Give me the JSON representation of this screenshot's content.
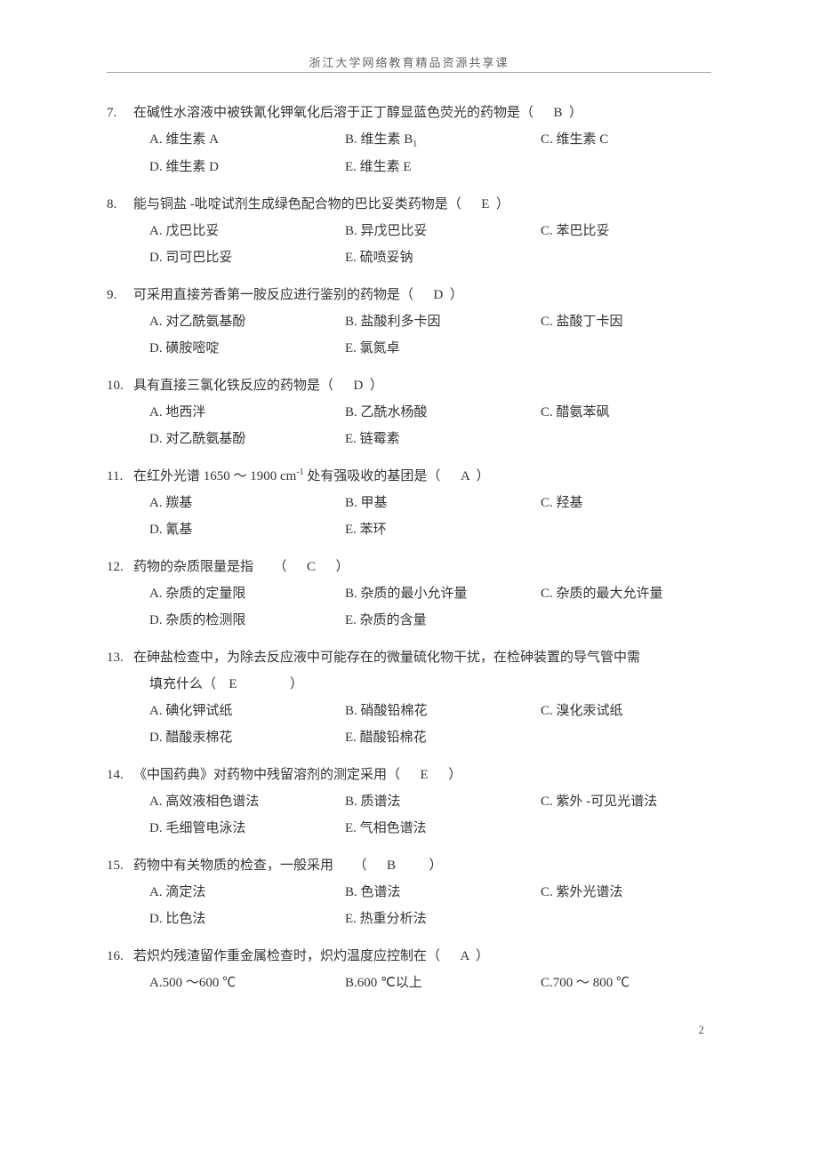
{
  "header": "浙江大学网络教育精品资源共享课",
  "page_number": "2",
  "questions": [
    {
      "num": "7.",
      "text_pre": "在碱性水溶液中被铁氰化钾氧化后溶于正丁醇显蓝色荧光的药物是（",
      "answer": "B",
      "text_post": "）",
      "rows": [
        [
          {
            "k": "A.",
            "v": "维生素 A"
          },
          {
            "k": "B.",
            "v": "维生素 B"
          },
          {
            "k": "C.",
            "v": "维生素 C"
          }
        ],
        [
          {
            "k": "D.",
            "v": "维生素 D"
          },
          {
            "k": "E.",
            "v": "维生素 E"
          }
        ]
      ],
      "b_sub": "1"
    },
    {
      "num": "8.",
      "text_pre": "能与铜盐 -吡啶试剂生成绿色配合物的巴比妥类药物是（",
      "answer": "E",
      "text_post": "）",
      "rows": [
        [
          {
            "k": "A.",
            "v": "戊巴比妥"
          },
          {
            "k": "B.",
            "v": "异戊巴比妥"
          },
          {
            "k": "C.",
            "v": "苯巴比妥"
          }
        ],
        [
          {
            "k": "D.",
            "v": "司可巴比妥"
          },
          {
            "k": "E.",
            "v": "硫喷妥钠"
          }
        ]
      ]
    },
    {
      "num": "9.",
      "text_pre": "可采用直接芳香第一胺反应进行鉴别的药物是（",
      "answer": "D",
      "text_post": "）",
      "rows": [
        [
          {
            "k": "A.",
            "v": "对乙酰氨基酚"
          },
          {
            "k": "B.",
            "v": "盐酸利多卡因"
          },
          {
            "k": "C.",
            "v": "盐酸丁卡因"
          }
        ],
        [
          {
            "k": "D.",
            "v": "磺胺嘧啶"
          },
          {
            "k": "E.",
            "v": "氯氮卓"
          }
        ]
      ]
    },
    {
      "num": "10.",
      "text_pre": "具有直接三氯化铁反应的药物是（",
      "answer": "D",
      "text_post": "）",
      "rows": [
        [
          {
            "k": "A.",
            "v": "地西泮"
          },
          {
            "k": "B.",
            "v": "乙酰水杨酸"
          },
          {
            "k": "C.",
            "v": "醋氨苯砜"
          }
        ],
        [
          {
            "k": "D.",
            "v": "对乙酰氨基酚"
          },
          {
            "k": "E.",
            "v": "链霉素"
          }
        ]
      ]
    },
    {
      "num": "11.",
      "text_pre": "在红外光谱 1650 ～ 1900 cm",
      "sup": "-1",
      "text_mid": " 处有强吸收的基团是（",
      "answer": "A",
      "text_post": "）",
      "rows": [
        [
          {
            "k": "A.",
            "v": "羰基"
          },
          {
            "k": "B.",
            "v": "甲基"
          },
          {
            "k": "C.",
            "v": "羟基"
          }
        ],
        [
          {
            "k": "D.",
            "v": "氰基"
          },
          {
            "k": "E.",
            "v": "苯环"
          }
        ]
      ]
    },
    {
      "num": "12.",
      "text_pre": "药物的杂质限量是指　　（",
      "answer": "C",
      "text_post": "　）",
      "rows": [
        [
          {
            "k": "A.",
            "v": "杂质的定量限"
          },
          {
            "k": "B.",
            "v": "杂质的最小允许量"
          },
          {
            "k": "C.",
            "v": "杂质的最大允许量"
          }
        ],
        [
          {
            "k": "D.",
            "v": "杂质的检测限"
          },
          {
            "k": "E.",
            "v": "杂质的含量"
          }
        ]
      ]
    },
    {
      "num": "13.",
      "text_pre": "在砷盐检查中，为除去反应液中可能存在的微量硫化物干扰，在检砷装置的导气管中需",
      "line2_pre": "填充什么（",
      "answer": "E",
      "line2_post": "　　　）",
      "rows": [
        [
          {
            "k": "A.",
            "v": "碘化钾试纸"
          },
          {
            "k": "B.",
            "v": "硝酸铅棉花"
          },
          {
            "k": "C.",
            "v": "溴化汞试纸"
          }
        ],
        [
          {
            "k": "D.",
            "v": "醋酸汞棉花"
          },
          {
            "k": "E.",
            "v": "醋酸铅棉花"
          }
        ]
      ]
    },
    {
      "num": "14.",
      "text_pre": "《中国药典》对药物中残留溶剂的测定采用（",
      "answer": "E",
      "text_post": "　）",
      "rows": [
        [
          {
            "k": "A.",
            "v": "高效液相色谱法"
          },
          {
            "k": "B.",
            "v": "质谱法"
          },
          {
            "k": "C.",
            "v": "紫外 -可见光谱法"
          }
        ],
        [
          {
            "k": "D.",
            "v": "毛细管电泳法"
          },
          {
            "k": "E.",
            "v": "气相色谱法"
          }
        ]
      ]
    },
    {
      "num": "15.",
      "text_pre": "药物中有关物质的检查，一般采用　　（",
      "answer": "B",
      "text_post": "　　）",
      "rows": [
        [
          {
            "k": "A.",
            "v": "滴定法"
          },
          {
            "k": "B.",
            "v": "色谱法"
          },
          {
            "k": "C.",
            "v": "紫外光谱法"
          }
        ],
        [
          {
            "k": "D.",
            "v": "比色法"
          },
          {
            "k": "E.",
            "v": "热重分析法"
          }
        ]
      ]
    },
    {
      "num": "16.",
      "text_pre": " 若炽灼残渣留作重金属检查时，炽灼温度应控制在（",
      "answer": "A",
      "text_post": "）",
      "rows": [
        [
          {
            "k": "A.",
            "v": "500 ～600 ℃"
          },
          {
            "k": "B.",
            "v": "600 ℃以上"
          },
          {
            "k": "C.",
            "v": "700 ～ 800 ℃"
          }
        ]
      ],
      "inline_key": true
    }
  ]
}
